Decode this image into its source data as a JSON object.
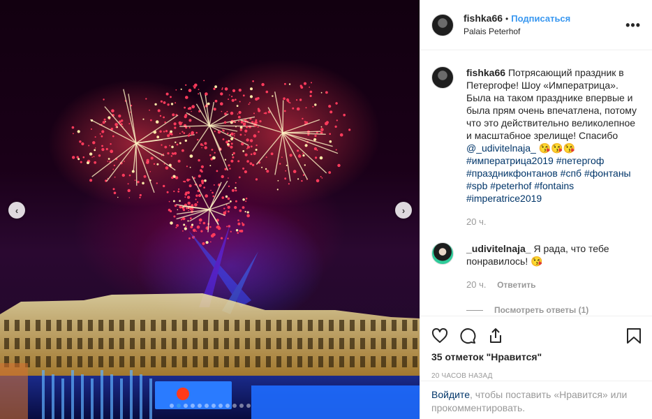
{
  "post": {
    "username": "fishka66",
    "separator": "•",
    "follow_label": "Подписаться",
    "location": "Palais Peterhof",
    "more_label": "•••"
  },
  "caption": {
    "username": "fishka66",
    "text": "Потрясающий праздник в Петергофе! Шоу «Императрица». Была на таком празднике впервые и была прям очень впечатлена, потому что это действительно великолепное и масштабное зрелище! Спасибо",
    "mention": "@_udivitelnaja_",
    "emojis": "😘😘😘",
    "hashtags": [
      "#императрица2019",
      "#петергоф",
      "#праздникфонтанов",
      "#спб",
      "#фонтаны",
      "#spb",
      "#peterhof",
      "#fontains",
      "#imperatrice2019"
    ],
    "time": "20 ч."
  },
  "reply": {
    "username": "_udivitelnaja_",
    "text": "Я рада, что тебе понравилось!",
    "emoji": "😘",
    "time": "20 ч.",
    "reply_label": "Ответить",
    "view_replies": "Посмотреть ответы (1)"
  },
  "stats": {
    "likes": "35 отметок \"Нравится\"",
    "timestamp": "20 ЧАСОВ НАЗАД"
  },
  "login": {
    "link": "Войдите",
    "text": ", чтобы поставить «Нравится» или прокомментировать."
  },
  "carousel": {
    "total": 12,
    "active": 1,
    "prev_icon": "chevron-left-icon",
    "next_icon": "chevron-right-icon"
  },
  "icons": [
    "heart-icon",
    "comment-icon",
    "share-icon",
    "bookmark-icon"
  ],
  "colors": {
    "accent": "#3897f0",
    "link": "#003569",
    "muted": "#999999"
  }
}
